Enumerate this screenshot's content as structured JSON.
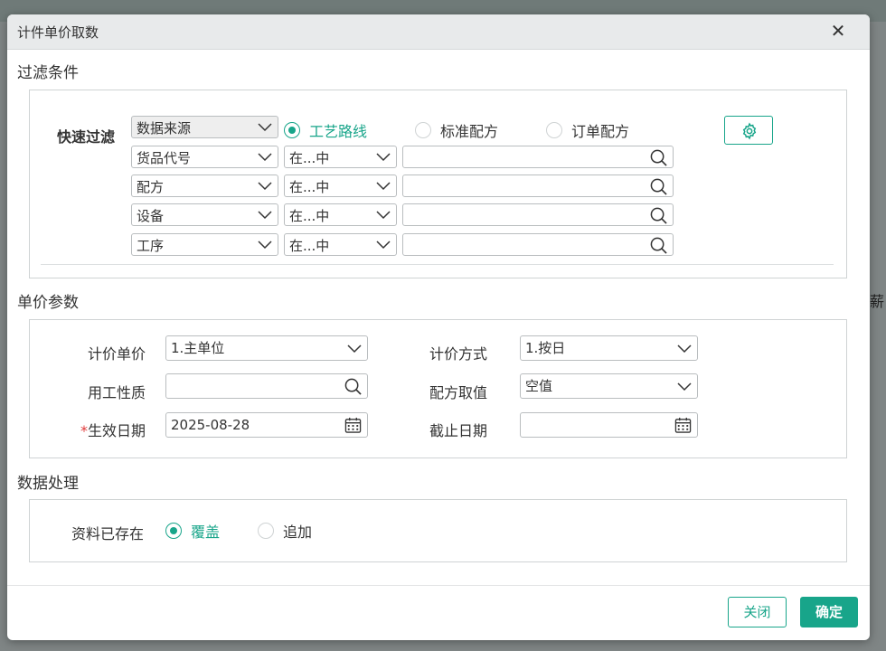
{
  "background": {
    "edge_char": "薪"
  },
  "dialog": {
    "title": "计件单价取数",
    "close_glyph": "✕"
  },
  "filter": {
    "section_title": "过滤条件",
    "quick_filter_label": "快速过滤",
    "source_select": "数据来源",
    "source_radios": [
      {
        "label": "工艺路线",
        "checked": true
      },
      {
        "label": "标准配方",
        "checked": false
      },
      {
        "label": "订单配方",
        "checked": false
      }
    ],
    "rows": [
      {
        "field": "货品代号",
        "operator": "在...中",
        "value": ""
      },
      {
        "field": "配方",
        "operator": "在...中",
        "value": ""
      },
      {
        "field": "设备",
        "operator": "在...中",
        "value": ""
      },
      {
        "field": "工序",
        "operator": "在...中",
        "value": ""
      }
    ]
  },
  "price": {
    "section_title": "单价参数",
    "unit_label": "计价单价",
    "unit_value": "1.主单位",
    "method_label": "计价方式",
    "method_value": "1.按日",
    "work_nature_label": "用工性质",
    "work_nature_value": "",
    "formula_label": "配方取值",
    "formula_value": "空值",
    "required_mark": "*",
    "effective_label": "生效日期",
    "effective_value": "2025-08-28",
    "end_label": "截止日期",
    "end_value": ""
  },
  "processing": {
    "section_title": "数据处理",
    "exists_label": "资料已存在",
    "options": [
      {
        "label": "覆盖",
        "checked": true
      },
      {
        "label": "追加",
        "checked": false
      }
    ]
  },
  "footer": {
    "close_label": "关闭",
    "confirm_label": "确定"
  },
  "colors": {
    "accent": "#18a58a",
    "required": "#e03a3a"
  }
}
